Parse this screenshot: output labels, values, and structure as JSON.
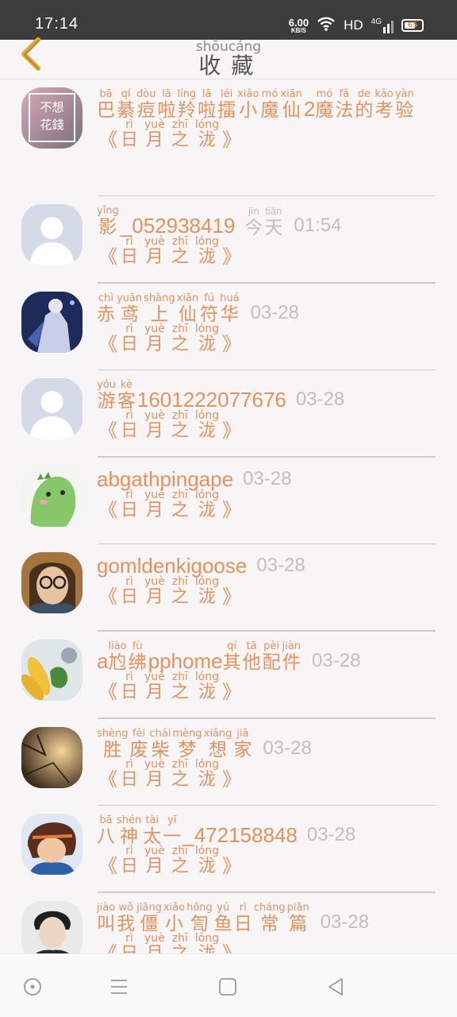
{
  "status_bar": {
    "time": "17:14",
    "net_speed": "6.00",
    "net_unit": "KB/S",
    "hd": "HD",
    "signal": "4G",
    "battery": "65"
  },
  "header": {
    "title": [
      {
        "py": "shōu",
        "hz": "收"
      },
      {
        "py": "cáng",
        "hz": "藏"
      }
    ],
    "back_icon": "chevron-left-icon"
  },
  "colors": {
    "accent": "#e6915d",
    "muted": "#bfbfbf",
    "divider": "#cfcbcb",
    "back": "#e2a830"
  },
  "favorites": [
    {
      "avatar": "avatar-text-image",
      "avatar_text": [
        "不想",
        "花錢"
      ],
      "name": [
        {
          "py": "bā",
          "hz": "巴"
        },
        {
          "py": "qí",
          "hz": "綦"
        },
        {
          "py": "dòu",
          "hz": "痘"
        },
        {
          "py": "lā",
          "hz": "啦"
        },
        {
          "py": "líng",
          "hz": "羚"
        },
        {
          "py": "lā",
          "hz": "啦"
        },
        {
          "py": "léi",
          "hz": "擂"
        },
        {
          "py": "xiǎo",
          "hz": "小"
        },
        {
          "py": "mó",
          "hz": "魔"
        },
        {
          "py": "xiān",
          "hz": "仙"
        },
        {
          "lat": "2"
        },
        {
          "py": "mó",
          "hz": "魔"
        },
        {
          "py": "fǎ",
          "hz": "法"
        },
        {
          "py": "de",
          "hz": "的"
        },
        {
          "py": "kǎo",
          "hz": "考"
        },
        {
          "py": "yàn",
          "hz": "验"
        }
      ],
      "time": "",
      "book": [
        {
          "py": "rì",
          "hz": "日"
        },
        {
          "py": "yuè",
          "hz": "月"
        },
        {
          "py": "zhī",
          "hz": "之"
        },
        {
          "py": "lóng",
          "hz": "泷"
        }
      ]
    },
    {
      "avatar": "default-user-icon",
      "name": [
        {
          "py": "yǐng",
          "hz": "影"
        },
        {
          "lat": "_052938419"
        }
      ],
      "time_ruby": [
        {
          "py": "jīn",
          "hz": "今"
        },
        {
          "py": "tiān",
          "hz": "天"
        }
      ],
      "time": "01:54",
      "book": [
        {
          "py": "rì",
          "hz": "日"
        },
        {
          "py": "yuè",
          "hz": "月"
        },
        {
          "py": "zhī",
          "hz": "之"
        },
        {
          "py": "lóng",
          "hz": "泷"
        }
      ]
    },
    {
      "avatar": "anime-character-avatar",
      "name": [
        {
          "py": "chì",
          "hz": "赤"
        },
        {
          "py": "yuān",
          "hz": "鸢"
        },
        {
          "py": "shàng",
          "hz": "上"
        },
        {
          "py": "xiān",
          "hz": "仙"
        },
        {
          "py": "fú",
          "hz": "符"
        },
        {
          "py": "huá",
          "hz": "华"
        }
      ],
      "time": "03-28",
      "book": [
        {
          "py": "rì",
          "hz": "日"
        },
        {
          "py": "yuè",
          "hz": "月"
        },
        {
          "py": "zhī",
          "hz": "之"
        },
        {
          "py": "lóng",
          "hz": "泷"
        }
      ]
    },
    {
      "avatar": "default-user-icon",
      "name": [
        {
          "py": "yóu",
          "hz": "游"
        },
        {
          "py": "kè",
          "hz": "客"
        },
        {
          "lat": "1601222077676"
        }
      ],
      "time": "03-28",
      "book": [
        {
          "py": "rì",
          "hz": "日"
        },
        {
          "py": "yuè",
          "hz": "月"
        },
        {
          "py": "zhī",
          "hz": "之"
        },
        {
          "py": "lóng",
          "hz": "泷"
        }
      ]
    },
    {
      "avatar": "green-dino-avatar",
      "name": [
        {
          "lat": "abgathpingape"
        }
      ],
      "time": "03-28",
      "book": [
        {
          "py": "rì",
          "hz": "日"
        },
        {
          "py": "yuè",
          "hz": "月"
        },
        {
          "py": "zhī",
          "hz": "之"
        },
        {
          "py": "lóng",
          "hz": "泷"
        }
      ]
    },
    {
      "avatar": "glasses-person-avatar",
      "name": [
        {
          "lat": "gomldenkigoose"
        }
      ],
      "time": "03-28",
      "book": [
        {
          "py": "rì",
          "hz": "日"
        },
        {
          "py": "yuè",
          "hz": "月"
        },
        {
          "py": "zhī",
          "hz": "之"
        },
        {
          "py": "lóng",
          "hz": "泷"
        }
      ]
    },
    {
      "avatar": "corn-food-avatar",
      "name": [
        {
          "lat": "a"
        },
        {
          "py": "liào",
          "hz": "尥"
        },
        {
          "py": "fù",
          "hz": "绋"
        },
        {
          "lat": "pphome"
        },
        {
          "py": "qí",
          "hz": "其"
        },
        {
          "py": "tā",
          "hz": "他"
        },
        {
          "py": "pèi",
          "hz": "配"
        },
        {
          "py": "jiàn",
          "hz": "件"
        }
      ],
      "time": "03-28",
      "book": [
        {
          "py": "rì",
          "hz": "日"
        },
        {
          "py": "yuè",
          "hz": "月"
        },
        {
          "py": "zhī",
          "hz": "之"
        },
        {
          "py": "lóng",
          "hz": "泷"
        }
      ]
    },
    {
      "avatar": "warm-photo-avatar",
      "name": [
        {
          "py": "shèng",
          "hz": "胜"
        },
        {
          "py": "fèi",
          "hz": "废"
        },
        {
          "py": "chái",
          "hz": "柴"
        },
        {
          "py": "mèng",
          "hz": "梦"
        },
        {
          "py": "xiǎng",
          "hz": "想"
        },
        {
          "py": "jiā",
          "hz": "家"
        }
      ],
      "time": "03-28",
      "book": [
        {
          "py": "rì",
          "hz": "日"
        },
        {
          "py": "yuè",
          "hz": "月"
        },
        {
          "py": "zhī",
          "hz": "之"
        },
        {
          "py": "lóng",
          "hz": "泷"
        }
      ]
    },
    {
      "avatar": "anime-boy-avatar",
      "name": [
        {
          "py": "bā",
          "hz": "八"
        },
        {
          "py": "shén",
          "hz": "神"
        },
        {
          "py": "tài",
          "hz": "太"
        },
        {
          "py": "yī",
          "hz": "一"
        },
        {
          "lat": "_472158848"
        }
      ],
      "time": "03-28",
      "book": [
        {
          "py": "rì",
          "hz": "日"
        },
        {
          "py": "yuè",
          "hz": "月"
        },
        {
          "py": "zhī",
          "hz": "之"
        },
        {
          "py": "lóng",
          "hz": "泷"
        }
      ]
    },
    {
      "avatar": "portrait-photo-avatar",
      "name": [
        {
          "py": "jiào",
          "hz": "叫"
        },
        {
          "py": "wǒ",
          "hz": "我"
        },
        {
          "py": "jiāng",
          "hz": "僵"
        },
        {
          "py": "xiǎo",
          "hz": "小"
        },
        {
          "py": "hōng",
          "hz": "訇"
        },
        {
          "py": "yú",
          "hz": "鱼"
        },
        {
          "py": "rì",
          "hz": "日"
        },
        {
          "py": "cháng",
          "hz": "常"
        },
        {
          "py": "piān",
          "hz": "篇"
        }
      ],
      "time": "03-28",
      "book": [
        {
          "py": "rì",
          "hz": "日"
        },
        {
          "py": "yuè",
          "hz": "月"
        },
        {
          "py": "zhī",
          "hz": "之"
        },
        {
          "py": "lóng",
          "hz": "泷"
        }
      ]
    }
  ],
  "book_quote_open": "《",
  "book_quote_close": "》",
  "nav_bar": [
    "circle-icon",
    "menu-icon",
    "square-icon",
    "triangle-back-icon"
  ]
}
